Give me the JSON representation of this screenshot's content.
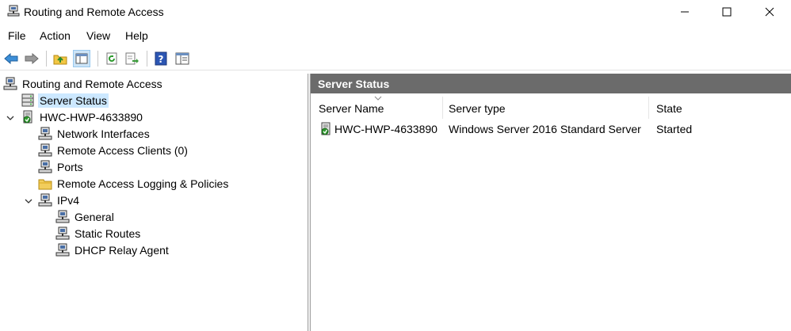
{
  "window": {
    "title": "Routing and Remote Access"
  },
  "menu": [
    "File",
    "Action",
    "View",
    "Help"
  ],
  "toolbar": {
    "buttons": [
      "back-icon",
      "forward-icon",
      "up-folder-icon",
      "show-hide-tree-icon",
      "refresh-icon",
      "export-list-icon",
      "help-icon",
      "properties-icon"
    ]
  },
  "tree": {
    "root": "Routing and Remote Access",
    "items": [
      {
        "label": "Server Status",
        "icon": "server-status-icon",
        "selected": true
      },
      {
        "label": "HWC-HWP-4633890",
        "icon": "server-icon"
      },
      {
        "label": "Network Interfaces",
        "icon": "network-icon"
      },
      {
        "label": "Remote Access Clients (0)",
        "icon": "network-icon"
      },
      {
        "label": "Ports",
        "icon": "network-icon"
      },
      {
        "label": "Remote Access Logging & Policies",
        "icon": "folder-icon"
      },
      {
        "label": "IPv4",
        "icon": "network-icon"
      },
      {
        "label": "General",
        "icon": "network-icon"
      },
      {
        "label": "Static Routes",
        "icon": "network-icon"
      },
      {
        "label": "DHCP Relay Agent",
        "icon": "network-icon"
      }
    ]
  },
  "right": {
    "header": "Server Status",
    "columns": [
      "Server Name",
      "Server type",
      "State"
    ],
    "rows": [
      {
        "name": "HWC-HWP-4633890",
        "type": "Windows Server 2016 Standard Server",
        "state": "Started"
      }
    ]
  }
}
